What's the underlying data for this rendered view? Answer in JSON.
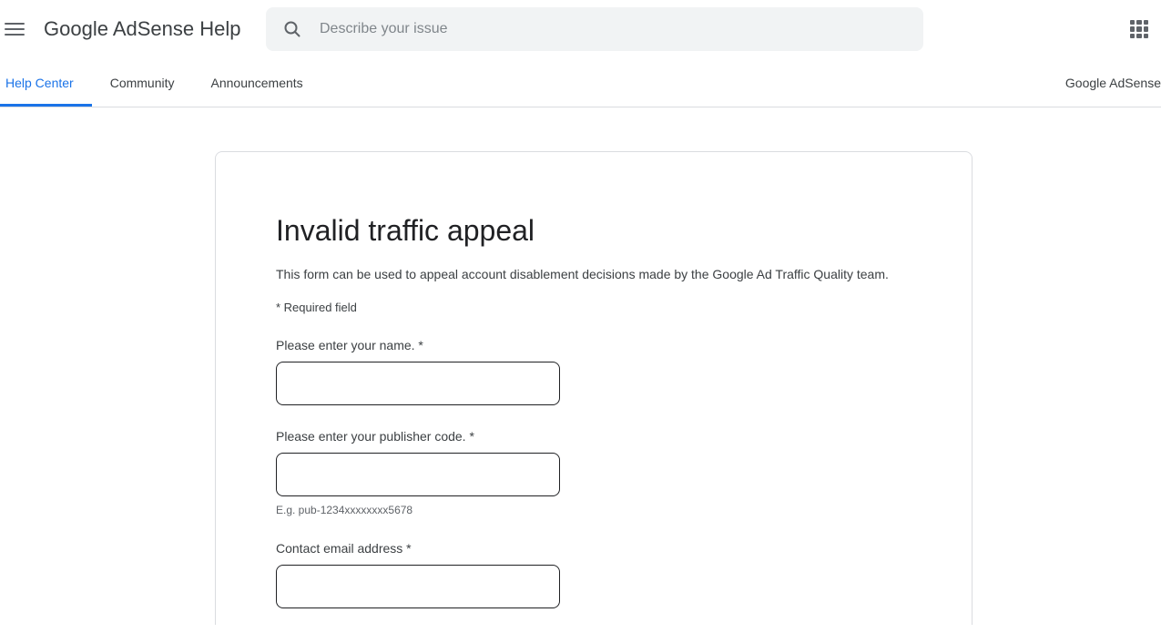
{
  "header": {
    "menu_icon": "hamburger-menu-icon",
    "title": "Google AdSense Help",
    "search": {
      "icon": "search-icon",
      "placeholder": "Describe your issue",
      "value": ""
    },
    "apps_icon": "google-apps-grid-icon"
  },
  "navigation": {
    "tabs": [
      {
        "label": "Help Center",
        "active": true
      },
      {
        "label": "Community",
        "active": false
      },
      {
        "label": "Announcements",
        "active": false
      }
    ],
    "product_link": "Google AdSense",
    "accent_color": "#1a73e8"
  },
  "form": {
    "title": "Invalid traffic appeal",
    "description": "This form can be used to appeal account disablement decisions made by the Google Ad Traffic Quality team.",
    "required_note": "* Required field",
    "fields": [
      {
        "label": "Please enter your name. *",
        "value": "",
        "placeholder": "",
        "help": ""
      },
      {
        "label": "Please enter your publisher code. *",
        "value": "",
        "placeholder": "",
        "help": "E.g. pub-1234xxxxxxxx5678"
      },
      {
        "label": "Contact email address *",
        "value": "",
        "placeholder": "",
        "help": ""
      }
    ]
  }
}
